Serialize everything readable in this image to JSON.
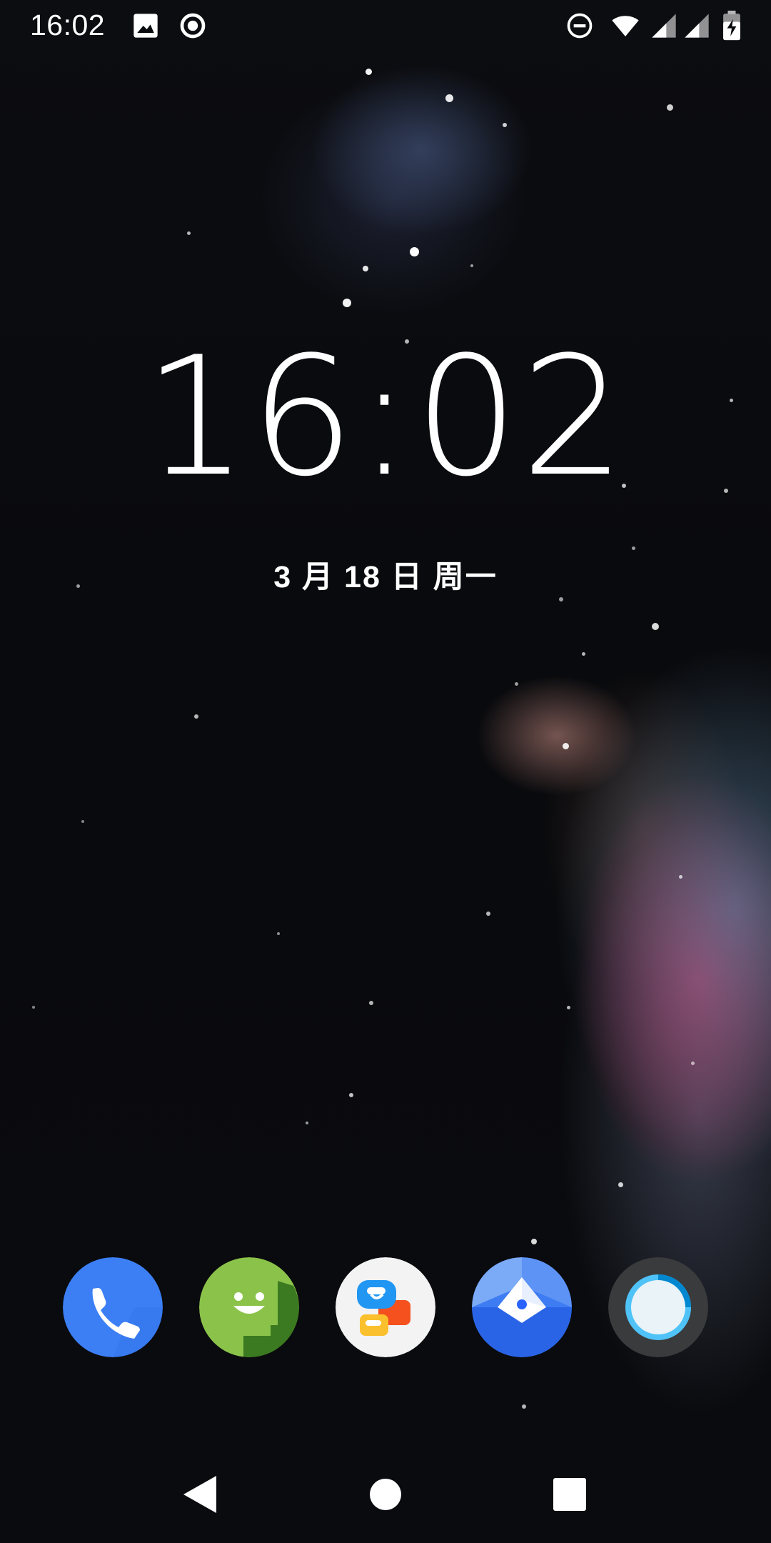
{
  "status_bar": {
    "time": "16:02",
    "left_icons": [
      "image-icon",
      "record-icon"
    ],
    "right_icons": [
      "do-not-disturb-icon",
      "wifi-icon",
      "signal-icon",
      "signal-icon-2",
      "battery-charging-icon"
    ]
  },
  "lock_clock": {
    "time": "16:02",
    "date": "3 月 18 日 周一"
  },
  "dock": {
    "apps": [
      {
        "name": "phone-app",
        "icon": "phone-icon"
      },
      {
        "name": "messaging-app",
        "icon": "messaging-icon"
      },
      {
        "name": "translate-chat-app",
        "icon": "translate-chat-icon"
      },
      {
        "name": "navigation-app",
        "icon": "navigation-icon"
      },
      {
        "name": "assistant-app",
        "icon": "assistant-ring-icon"
      }
    ]
  },
  "nav_bar": {
    "buttons": [
      "back-icon",
      "home-icon",
      "recent-apps-icon"
    ]
  },
  "colors": {
    "phone_blue": "#3b82f6",
    "messaging_green": "#7cb342",
    "nav_blue": "#2f6df0",
    "ring_dark": "#3a3b3d",
    "ring_blue": "#4fc3f7"
  }
}
